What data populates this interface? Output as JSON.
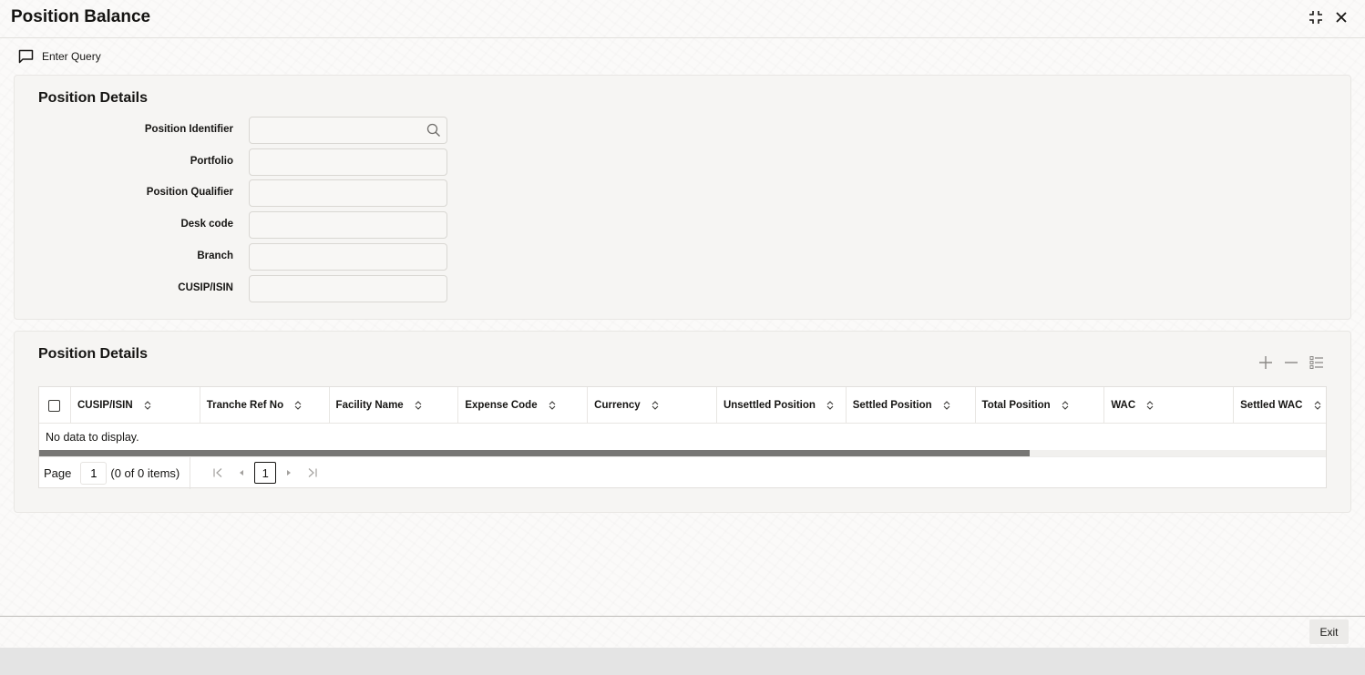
{
  "window": {
    "title": "Position Balance",
    "icons": {
      "restore": "compress-icon",
      "close": "close-icon"
    }
  },
  "toolbar": {
    "enter_query_label": "Enter Query",
    "enter_query_icon": "chat-bubble-icon"
  },
  "query_panel": {
    "title": "Position Details",
    "fields": [
      {
        "label": "Position Identifier",
        "value": "",
        "has_lookup": true
      },
      {
        "label": "Portfolio",
        "value": ""
      },
      {
        "label": "Position Qualifier",
        "value": ""
      },
      {
        "label": "Desk code",
        "value": ""
      },
      {
        "label": "Branch",
        "value": ""
      },
      {
        "label": "CUSIP/ISIN",
        "value": ""
      }
    ]
  },
  "grid_panel": {
    "title": "Position Details",
    "actions": [
      "add-icon",
      "remove-icon",
      "column-list-icon"
    ],
    "columns": [
      "CUSIP/ISIN",
      "Tranche Ref No",
      "Facility Name",
      "Expense Code",
      "Currency",
      "Unsettled Position",
      "Settled Position",
      "Total Position",
      "WAC",
      "Settled WAC"
    ],
    "rows": [],
    "empty_text": "No data to display.",
    "horizontal_scroll_fraction": 0.77,
    "pagination": {
      "page_label": "Page",
      "page_value": "1",
      "items_text": "(0 of 0 items)",
      "current_page": "1"
    }
  },
  "footer": {
    "exit_label": "Exit"
  }
}
